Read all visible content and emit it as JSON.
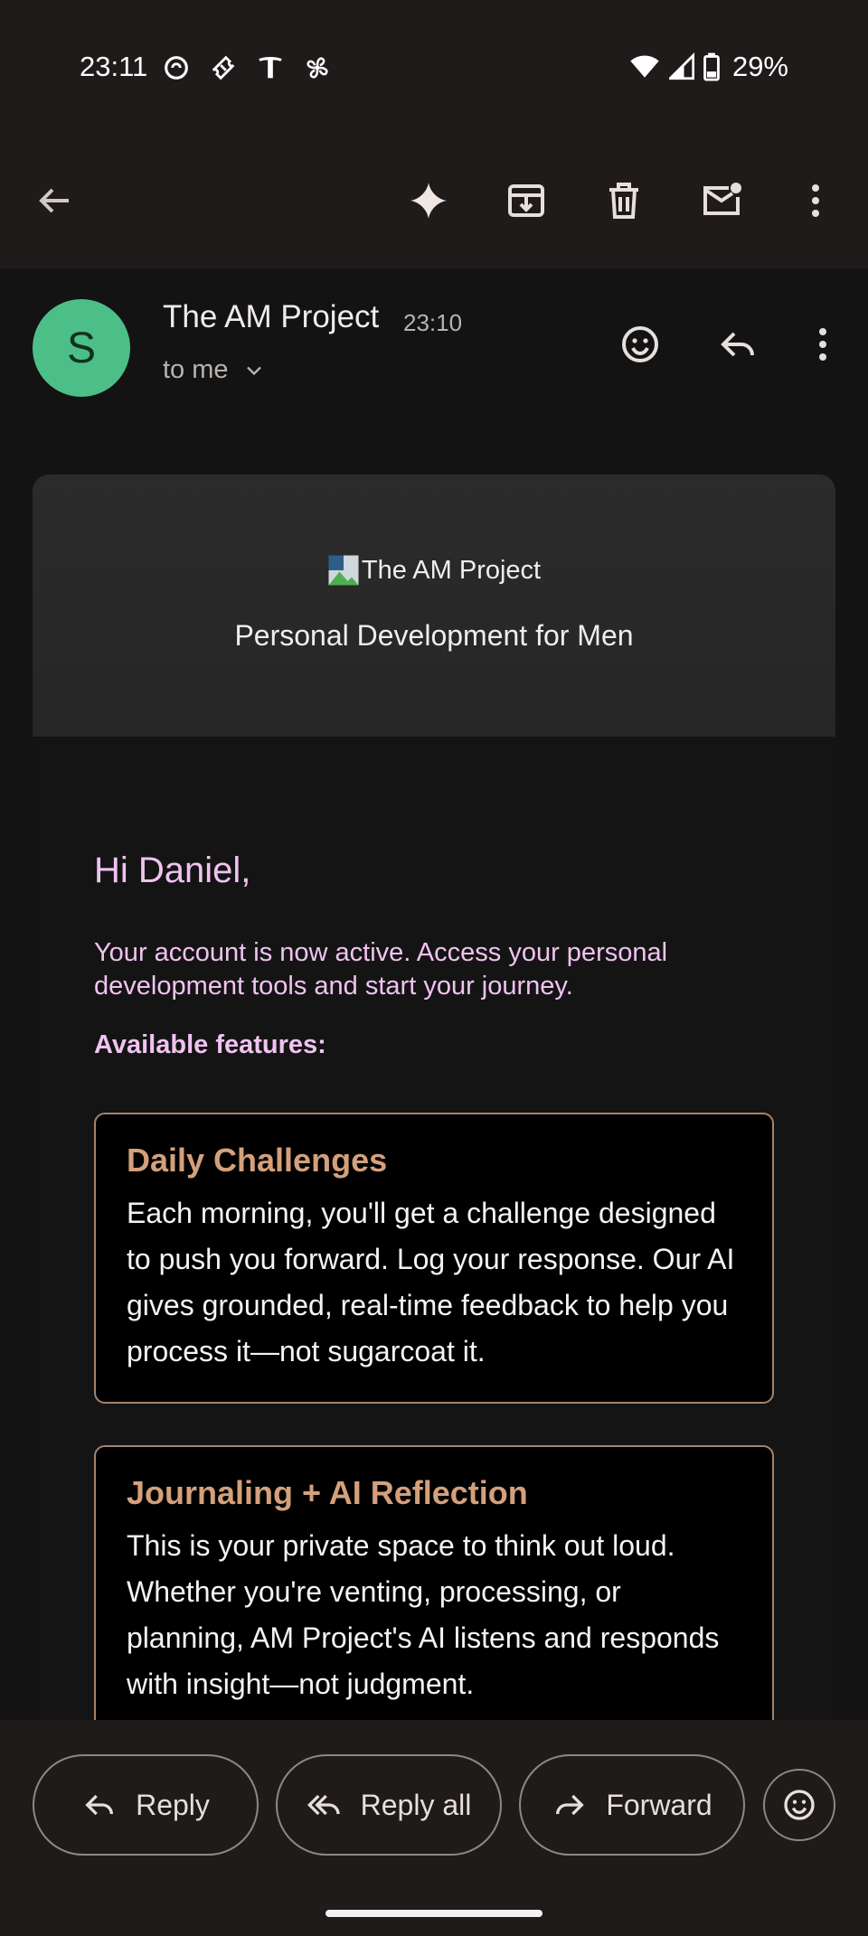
{
  "status_bar": {
    "time": "23:11",
    "battery": "29%",
    "left_icons": [
      "sync-circle-icon",
      "ticket-icon",
      "tesla-icon",
      "fan-icon"
    ],
    "right_icons": [
      "wifi-icon",
      "signal-icon",
      "battery-icon"
    ]
  },
  "toolbar": {
    "icons": [
      "back-arrow-icon",
      "sparkle-icon",
      "archive-icon",
      "trash-icon",
      "mark-unread-icon",
      "more-vert-icon"
    ]
  },
  "message": {
    "avatar_letter": "S",
    "avatar_color": "#4cbf89",
    "sender": "The AM Project",
    "time": "23:10",
    "recipient": "to me"
  },
  "email": {
    "brand_alt": "The AM Project",
    "tagline": "Personal Development for Men",
    "greeting": "Hi Daniel,",
    "intro": "Your account is now active. Access your personal development tools and start your journey.",
    "features_label": "Available features:",
    "features": [
      {
        "title": "Daily Challenges",
        "text": "Each morning, you'll get a challenge designed to push you forward. Log your response. Our AI gives grounded, real-time feedback to help you process it—not sugarcoat it."
      },
      {
        "title": "Journaling + AI Reflection",
        "text": "This is your private space to think out loud. Whether you're venting, processing, or planning, AM Project's AI listens and responds with insight—not judgment."
      }
    ]
  },
  "actions": {
    "reply": "Reply",
    "reply_all": "Reply all",
    "forward": "Forward"
  },
  "colors": {
    "accent_pink": "#f0c3f0",
    "accent_tan": "#d4a07b",
    "avatar_green": "#4cbf89"
  }
}
